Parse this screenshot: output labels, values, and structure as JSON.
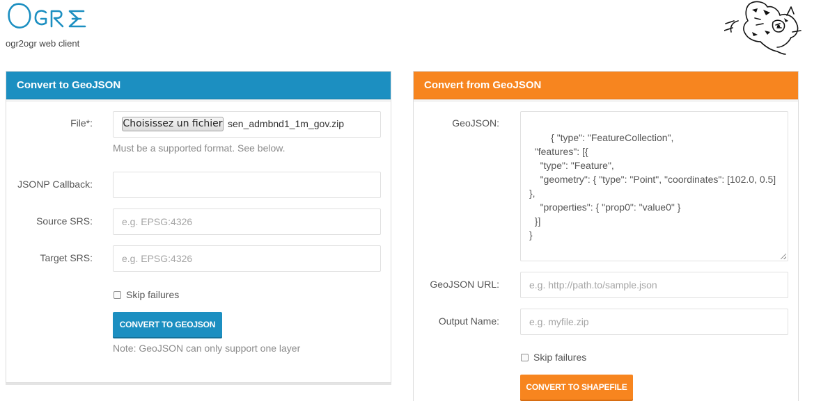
{
  "header": {
    "logo_text": "Ogre",
    "subtitle": "ogr2ogr web client"
  },
  "to_geojson": {
    "title": "Convert to GeoJSON",
    "file_label": "File*:",
    "file_button": "Choisissez un fichier",
    "file_name": "sen_admbnd1_1m_gov.zip",
    "file_help": "Must be a supported format. See below.",
    "jsonp_label": "JSONP Callback:",
    "jsonp_value": "",
    "source_srs_label": "Source SRS:",
    "source_srs_placeholder": "e.g. EPSG:4326",
    "target_srs_label": "Target SRS:",
    "target_srs_placeholder": "e.g. EPSG:4326",
    "skip_failures_label": "Skip failures",
    "skip_failures_checked": false,
    "submit_label": "CONVERT TO GEOJSON",
    "note": "Note: GeoJSON can only support one layer",
    "accent_color": "#1c8fc1"
  },
  "from_geojson": {
    "title": "Convert from GeoJSON",
    "geojson_label": "GeoJSON:",
    "geojson_value": "{ \"type\": \"FeatureCollection\",\n  \"features\": [{\n    \"type\": \"Feature\",\n    \"geometry\": { \"type\": \"Point\", \"coordinates\": [102.0, 0.5] },\n    \"properties\": { \"prop0\": \"value0\" }\n  }]\n}",
    "url_label": "GeoJSON URL:",
    "url_placeholder": "e.g. http://path.to/sample.json",
    "output_name_label": "Output Name:",
    "output_name_placeholder": "e.g. myfile.zip",
    "skip_failures_label": "Skip failures",
    "skip_failures_checked": false,
    "submit_label": "CONVERT TO SHAPEFILE",
    "accent_color": "#f7851f"
  }
}
